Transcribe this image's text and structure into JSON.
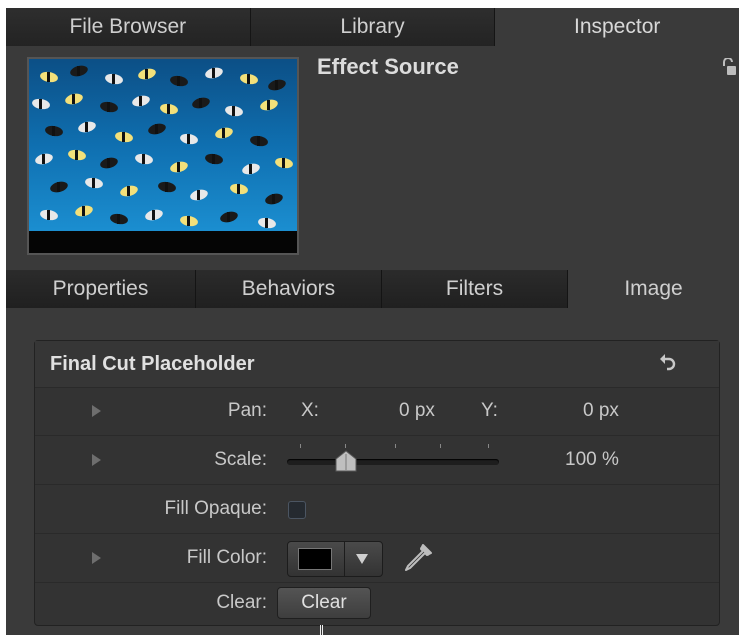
{
  "top_tabs": [
    {
      "label": "File Browser",
      "active": false
    },
    {
      "label": "Library",
      "active": false
    },
    {
      "label": "Inspector",
      "active": true
    }
  ],
  "header": {
    "title": "Effect Source",
    "thumbnail_icon": "fish-school-thumbnail",
    "lock_icon": "unlock-icon"
  },
  "sub_tabs": [
    {
      "label": "Properties",
      "active": false
    },
    {
      "label": "Behaviors",
      "active": false
    },
    {
      "label": "Filters",
      "active": false
    },
    {
      "label": "Image",
      "active": true
    }
  ],
  "panel": {
    "title": "Final Cut Placeholder",
    "reset_icon": "reset-arrow-icon",
    "pan": {
      "label": "Pan:",
      "x_label": "X:",
      "x_value": "0 px",
      "y_label": "Y:",
      "y_value": "0 px"
    },
    "scale": {
      "label": "Scale:",
      "value": "100 %",
      "slider_fraction": 0.27
    },
    "fill_opaque": {
      "label": "Fill Opaque:",
      "checked": false
    },
    "fill_color": {
      "label": "Fill Color:",
      "color": "#000000"
    },
    "clear": {
      "label": "Clear:",
      "button_label": "Clear"
    }
  },
  "colors": {
    "panel_bg": "#333333",
    "tab_inactive": "#232323",
    "tab_active": "#3a3a3a",
    "text": "#d8d8d8"
  }
}
